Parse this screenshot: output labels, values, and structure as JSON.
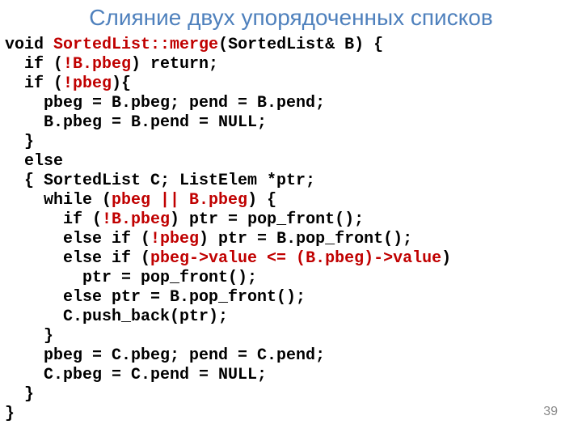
{
  "title": "Слияние двух упорядоченных списков",
  "page_number": "39",
  "code": {
    "l01a": "void ",
    "l01b": "SortedList::merge",
    "l01c": "(SortedList& B) {",
    "l02a": "  if (",
    "l02b": "!B.pbeg",
    "l02c": ") return;",
    "l03a": "  if (",
    "l03b": "!pbeg",
    "l03c": "){",
    "l04": "    pbeg = B.pbeg; pend = B.pend;",
    "l05": "    B.pbeg = B.pend = NULL;",
    "l06": "  }",
    "l07": "  else",
    "l08": "  { SortedList C; ListElem *ptr;",
    "l09a": "    while (",
    "l09b": "pbeg || B.pbeg",
    "l09c": ") {",
    "l10a": "      if (",
    "l10b": "!B.pbeg",
    "l10c": ") ptr = pop_front();",
    "l11a": "      else if (",
    "l11b": "!pbeg",
    "l11c": ") ptr = B.pop_front();",
    "l12a": "      else if (",
    "l12b": "pbeg->value <= (B.pbeg)->value",
    "l12c": ")",
    "l13": "        ptr = pop_front();",
    "l14": "      else ptr = B.pop_front();",
    "l15": "      C.push_back(ptr);",
    "l16": "    }",
    "l17": "    pbeg = C.pbeg; pend = C.pend;",
    "l18": "    C.pbeg = C.pend = NULL;",
    "l19": "  }",
    "l20": "}"
  }
}
